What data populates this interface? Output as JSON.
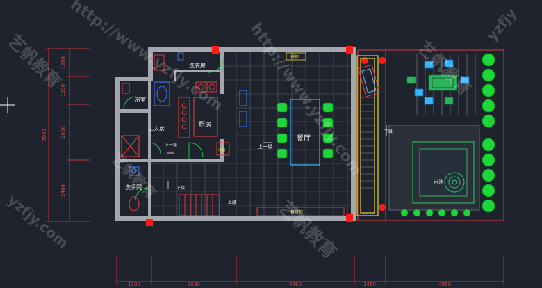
{
  "rooms": {
    "laundry": "洗衣房",
    "bathroom": "浴室",
    "kitchen": "厨房",
    "worker": "工人房",
    "washroom": "洗手间",
    "dining": "餐厅",
    "pool": "水池"
  },
  "annotations": {
    "down_1": "下一级",
    "down_2": "下一级",
    "down_3": "下一级",
    "up_1": "上一级",
    "down": "下级",
    "up": "上级",
    "down_right": "下级",
    "fridge": "冰箱",
    "cabinet": "餐柜",
    "sideboard": "备餐柜"
  },
  "dimensions": {
    "left": [
      "1200",
      "1300",
      "2650",
      "2400",
      "7800"
    ],
    "bottom": [
      "1200",
      "3530",
      "4760",
      "1450",
      "4050"
    ]
  },
  "watermarks": {
    "text_1": "http://www.yzfjy.com",
    "text_2": "http://www.yzfjy.com",
    "text_3": "艺帆教育",
    "text_4": "艺帆教育",
    "text_5": "yzfjy.com",
    "text_6": "艺帆教育",
    "text_7": "yzfjy",
    "text_8": "艺帆教育"
  }
}
